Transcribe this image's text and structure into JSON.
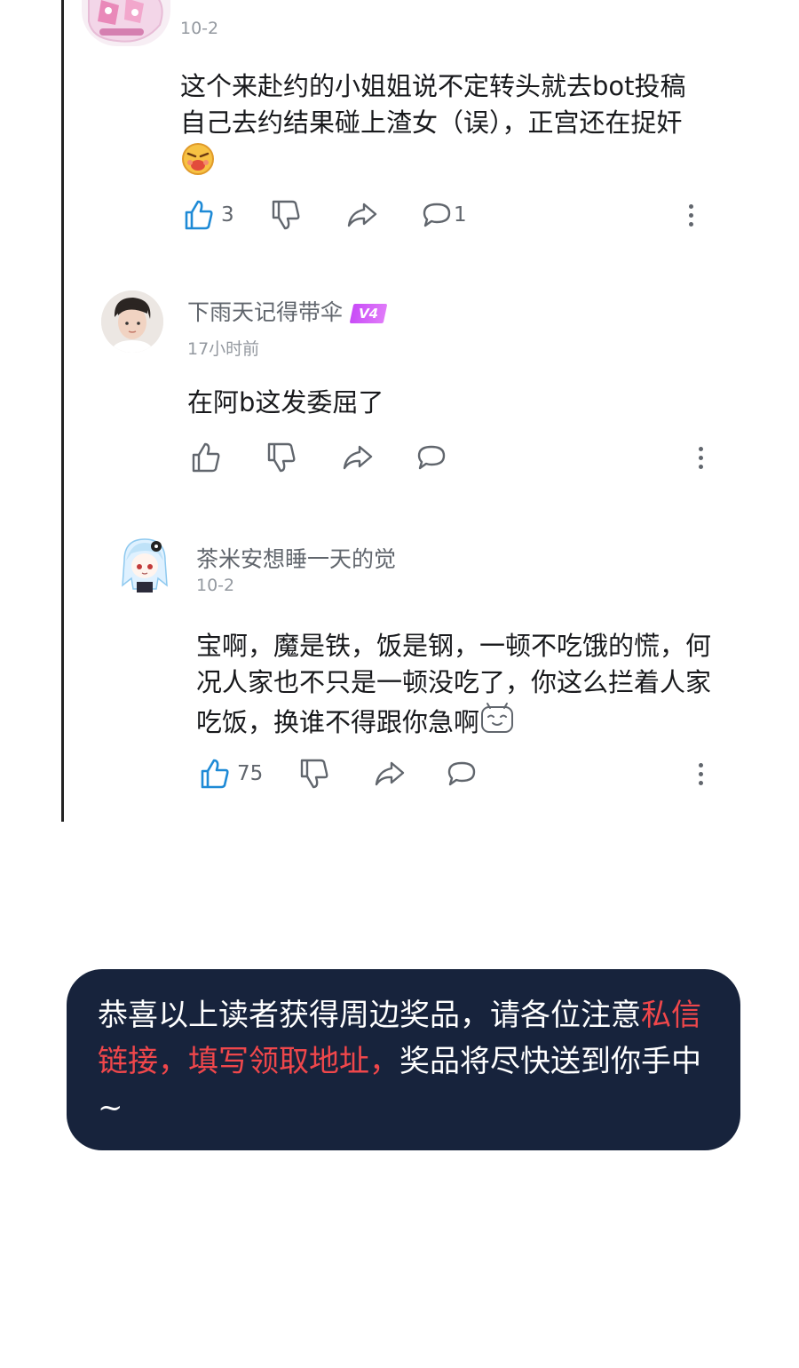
{
  "comments": [
    {
      "username": "",
      "time": "10-2",
      "text": "这个来赴约的小姐姐说不定转头就去bot投稿自己去约结果碰上渣女（误），正宫还在捉奸",
      "likes": "3",
      "replies": "1",
      "liked": true
    },
    {
      "username": "下雨天记得带伞",
      "badge": "V4",
      "time": "17小时前",
      "text": "在阿b这发委屈了",
      "likes": "",
      "replies": "",
      "liked": false
    },
    {
      "username": "茶米安想睡一天的觉",
      "time": "10-2",
      "text": "宝啊，魔是铁，饭是钢，一顿不吃饿的慌，何况人家也不只是一顿没吃了，你这么拦着人家吃饭，换谁不得跟你急啊",
      "likes": "75",
      "replies": "",
      "liked": true
    }
  ],
  "banner": {
    "text_before": "恭喜以上读者获得周边奖品，请各位注意",
    "highlight": "私信链接，填写领取地址，",
    "text_after": "奖品将尽快送到你手中~"
  },
  "colors": {
    "accent_blue": "#1e8ad6",
    "icon_gray": "#61666d",
    "banner_bg": "#17233c",
    "banner_highlight": "#f0474b"
  },
  "icons": {
    "like": "thumbs-up-icon",
    "dislike": "thumbs-down-icon",
    "share": "share-arrow-icon",
    "reply": "comment-bubble-icon",
    "more": "more-vertical-icon"
  }
}
